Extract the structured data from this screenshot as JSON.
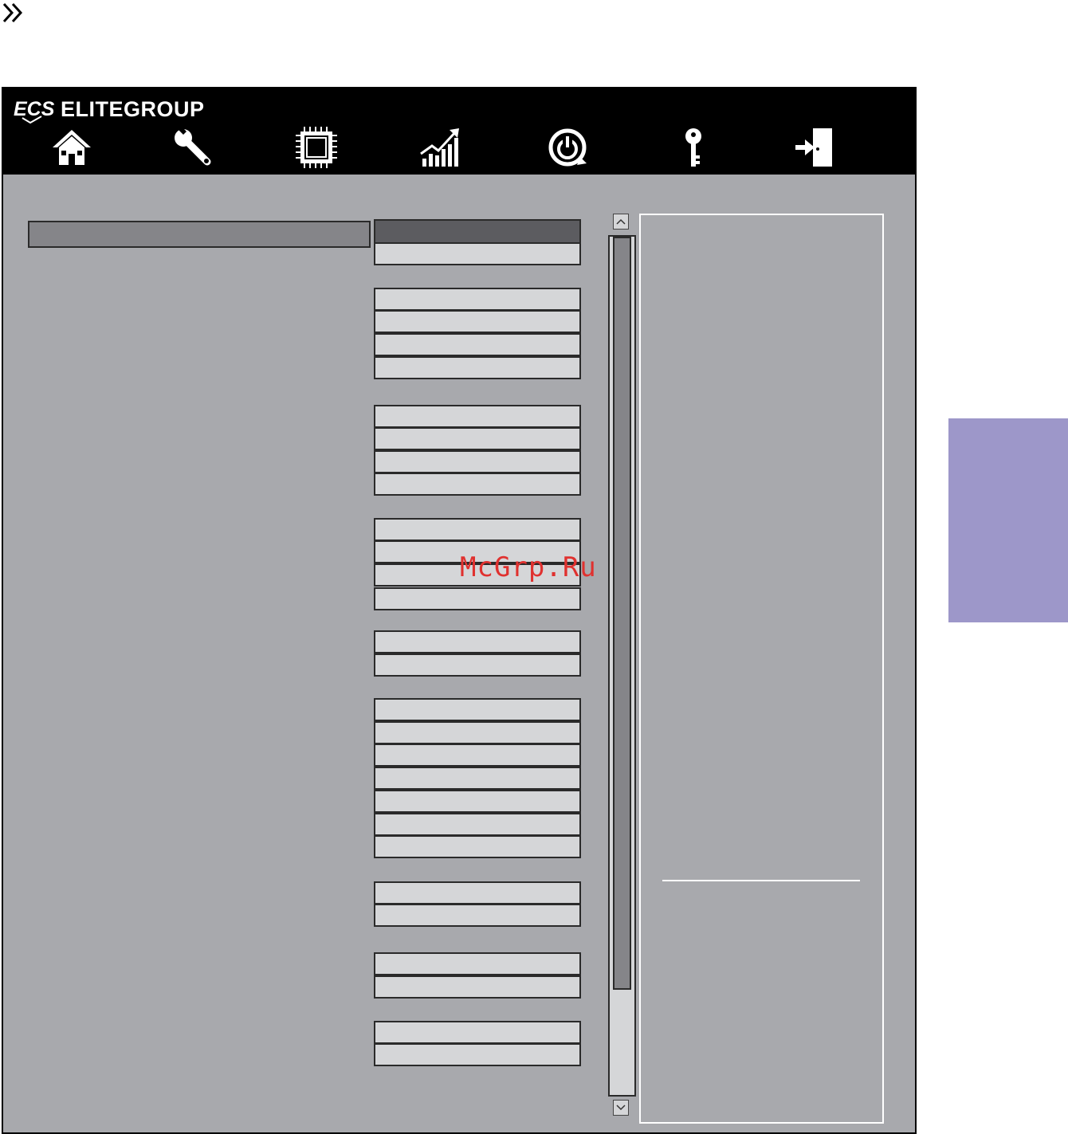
{
  "brand": {
    "name": "ELITEGROUP",
    "logo_text": "ECS"
  },
  "nav": {
    "items": [
      {
        "icon": "home-icon"
      },
      {
        "icon": "wrench-icon"
      },
      {
        "icon": "chip-icon"
      },
      {
        "icon": "performance-chart-icon"
      },
      {
        "icon": "power-icon"
      },
      {
        "icon": "key-icon"
      },
      {
        "icon": "exit-door-icon"
      }
    ]
  },
  "page_marker_icon": "double-chevron-right-icon",
  "watermark": "McGrp.Ru",
  "colors": {
    "header_bg": "#000000",
    "panel_bg": "#a8a9ad",
    "cell_bg": "#d5d6d8",
    "selected_cell_bg": "#5c5c60",
    "side_tab": "#9d97c9",
    "watermark": "#e0312f"
  }
}
